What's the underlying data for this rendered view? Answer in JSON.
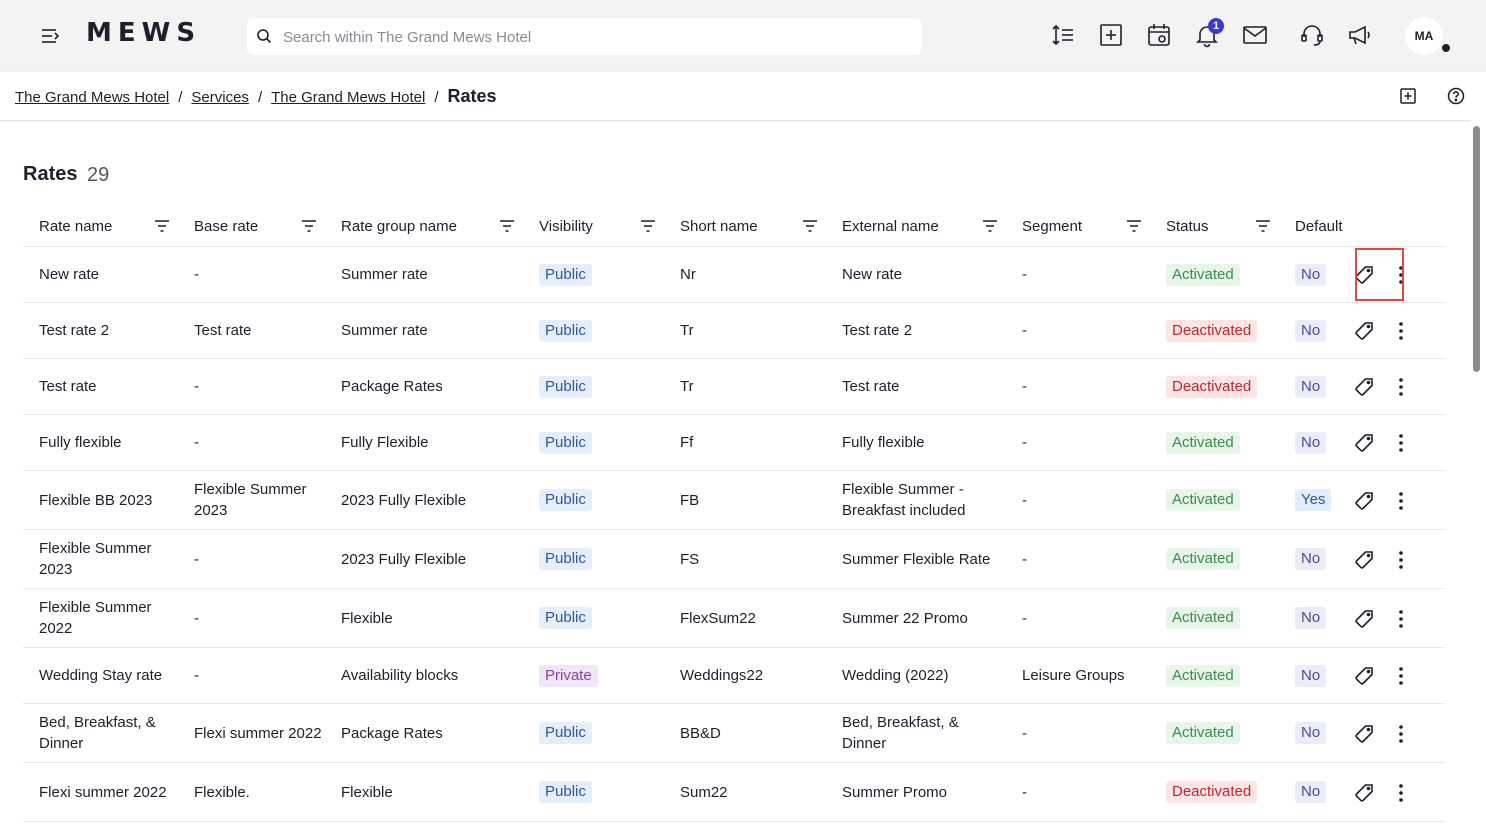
{
  "app": {
    "logo": "MEWS",
    "search": {
      "placeholder": "Search within The Grand Mews Hotel",
      "value": ""
    },
    "notifications_count": "1",
    "user_initials": "MA"
  },
  "breadcrumb": {
    "items": [
      "The Grand Mews Hotel",
      "Services",
      "The Grand Mews Hotel"
    ],
    "separator": "/",
    "current": "Rates"
  },
  "page": {
    "title": "Rates",
    "count": "29"
  },
  "table": {
    "columns": [
      "Rate name",
      "Base rate",
      "Rate group name",
      "Visibility",
      "Short name",
      "External name",
      "Segment",
      "Status",
      "Default"
    ],
    "rows": [
      {
        "rate_name": "New rate",
        "base_rate": "-",
        "group": "Summer rate",
        "visibility": "Public",
        "short": "Nr",
        "external": "New rate",
        "segment": "-",
        "status": "Activated",
        "default": "No"
      },
      {
        "rate_name": "Test rate 2",
        "base_rate": "Test rate",
        "group": "Summer rate",
        "visibility": "Public",
        "short": "Tr",
        "external": "Test rate 2",
        "segment": "-",
        "status": "Deactivated",
        "default": "No"
      },
      {
        "rate_name": "Test rate",
        "base_rate": "-",
        "group": "Package Rates",
        "visibility": "Public",
        "short": "Tr",
        "external": "Test rate",
        "segment": "-",
        "status": "Deactivated",
        "default": "No"
      },
      {
        "rate_name": "Fully flexible",
        "base_rate": "-",
        "group": "Fully Flexible",
        "visibility": "Public",
        "short": "Ff",
        "external": "Fully flexible",
        "segment": "-",
        "status": "Activated",
        "default": "No"
      },
      {
        "rate_name": "Flexible BB 2023",
        "base_rate": "Flexible Summer 2023",
        "group": "2023 Fully Flexible",
        "visibility": "Public",
        "short": "FB",
        "external": "Flexible Summer - Breakfast included",
        "segment": "-",
        "status": "Activated",
        "default": "Yes"
      },
      {
        "rate_name": "Flexible Summer 2023",
        "base_rate": "-",
        "group": "2023 Fully Flexible",
        "visibility": "Public",
        "short": "FS",
        "external": "Summer Flexible Rate",
        "segment": "-",
        "status": "Activated",
        "default": "No"
      },
      {
        "rate_name": "Flexible Summer 2022",
        "base_rate": "-",
        "group": "Flexible",
        "visibility": "Public",
        "short": "FlexSum22",
        "external": "Summer 22 Promo",
        "segment": "-",
        "status": "Activated",
        "default": "No"
      },
      {
        "rate_name": "Wedding Stay rate",
        "base_rate": "-",
        "group": "Availability blocks",
        "visibility": "Private",
        "short": "Weddings22",
        "external": "Wedding (2022)",
        "segment": "Leisure Groups",
        "status": "Activated",
        "default": "No"
      },
      {
        "rate_name": "Bed, Breakfast, & Dinner",
        "base_rate": "Flexi summer 2022",
        "group": "Package Rates",
        "visibility": "Public",
        "short": "BB&D",
        "external": "Bed, Breakfast, & Dinner",
        "segment": "-",
        "status": "Activated",
        "default": "No"
      },
      {
        "rate_name": "Flexi summer 2022",
        "base_rate": "Flexible.",
        "group": "Flexible",
        "visibility": "Public",
        "short": "Sum22",
        "external": "Summer Promo",
        "segment": "-",
        "status": "Deactivated",
        "default": "No"
      }
    ]
  },
  "colors": {
    "accent_highlight": "#e8473d",
    "badge_notification": "#3838e0",
    "topbar_bg": "#f3f3f3"
  },
  "icons": {
    "toolbar": [
      "sort-lines-icon",
      "add-square-icon",
      "calendar-icon",
      "bell-icon",
      "mail-icon",
      "headset-icon",
      "megaphone-icon"
    ],
    "row_actions": [
      "price-tag-icon",
      "more-vertical-icon"
    ]
  }
}
